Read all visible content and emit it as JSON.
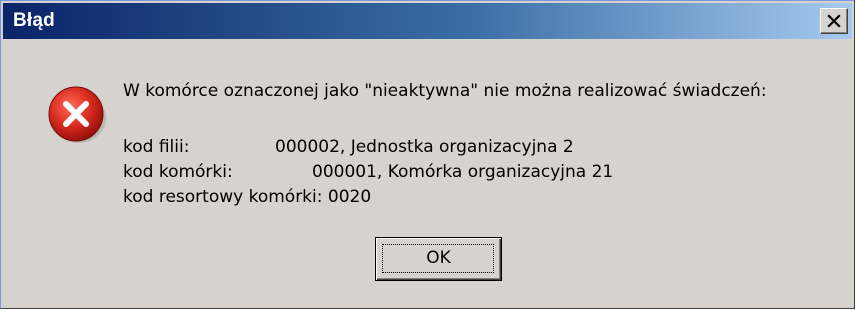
{
  "dialog": {
    "title": "Błąd",
    "close_glyph": "×",
    "icon": "error-icon",
    "message": "W komórce oznaczonej jako \"nieaktywna\" nie można realizować świadczeń:",
    "details": {
      "filia_label": "kod filii:",
      "filia_value": "000002, Jednostka organizacyjna 2",
      "komorka_label": "kod komórki:",
      "komorka_value": "000001, Komórka organizacyjna 21",
      "resortowy": "kod resortowy komórki: 0020"
    },
    "ok_label": "OK"
  },
  "colors": {
    "titlebar_start": "#0a246a",
    "titlebar_end": "#a6caf0",
    "dialog_bg": "#d6d3ce",
    "error_red": "#d62a1e"
  }
}
